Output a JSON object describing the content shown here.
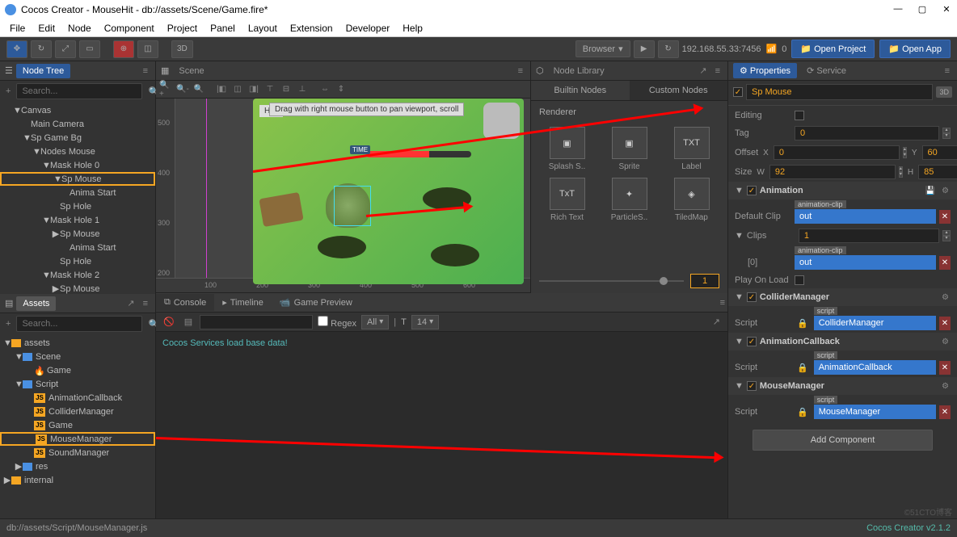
{
  "titlebar": {
    "title": "Cocos Creator - MouseHit - db://assets/Scene/Game.fire*"
  },
  "menubar": [
    "File",
    "Edit",
    "Node",
    "Component",
    "Project",
    "Panel",
    "Layout",
    "Extension",
    "Developer",
    "Help"
  ],
  "toolbar": {
    "mode_3d": "3D",
    "device": "Browser",
    "ip": "192.168.55.33:7456",
    "conn": "0",
    "open_project": "Open Project",
    "open_app": "Open App"
  },
  "node_tree": {
    "title": "Node Tree",
    "search_placeholder": "Search...",
    "items": [
      {
        "label": "Canvas",
        "indent": 1,
        "arrow": "▼"
      },
      {
        "label": "Main Camera",
        "indent": 2,
        "arrow": ""
      },
      {
        "label": "Sp Game Bg",
        "indent": 2,
        "arrow": "▼"
      },
      {
        "label": "Nodes Mouse",
        "indent": 3,
        "arrow": "▼"
      },
      {
        "label": "Mask Hole 0",
        "indent": 4,
        "arrow": "▼"
      },
      {
        "label": "Sp Mouse",
        "indent": 5,
        "arrow": "▼",
        "hl": true
      },
      {
        "label": "Anima Start",
        "indent": 6,
        "arrow": ""
      },
      {
        "label": "Sp Hole",
        "indent": 5,
        "arrow": ""
      },
      {
        "label": "Mask Hole 1",
        "indent": 4,
        "arrow": "▼"
      },
      {
        "label": "Sp Mouse",
        "indent": 5,
        "arrow": "▶"
      },
      {
        "label": "Anima Start",
        "indent": 6,
        "arrow": ""
      },
      {
        "label": "Sp Hole",
        "indent": 5,
        "arrow": ""
      },
      {
        "label": "Mask Hole 2",
        "indent": 4,
        "arrow": "▼"
      },
      {
        "label": "Sp Mouse",
        "indent": 5,
        "arrow": "▶"
      }
    ]
  },
  "assets": {
    "title": "Assets",
    "search_placeholder": "Search...",
    "items": [
      {
        "label": "assets",
        "indent": 0,
        "arrow": "▼",
        "icon": "folder-orange"
      },
      {
        "label": "Scene",
        "indent": 1,
        "arrow": "▼",
        "icon": "folder"
      },
      {
        "label": "Game",
        "indent": 2,
        "arrow": "",
        "icon": "fire"
      },
      {
        "label": "Script",
        "indent": 1,
        "arrow": "▼",
        "icon": "folder"
      },
      {
        "label": "AnimationCallback",
        "indent": 2,
        "arrow": "",
        "icon": "js"
      },
      {
        "label": "ColliderManager",
        "indent": 2,
        "arrow": "",
        "icon": "js"
      },
      {
        "label": "Game",
        "indent": 2,
        "arrow": "",
        "icon": "js"
      },
      {
        "label": "MouseManager",
        "indent": 2,
        "arrow": "",
        "icon": "js",
        "hl": true
      },
      {
        "label": "SoundManager",
        "indent": 2,
        "arrow": "",
        "icon": "js"
      },
      {
        "label": "res",
        "indent": 1,
        "arrow": "▶",
        "icon": "folder"
      },
      {
        "label": "internal",
        "indent": 0,
        "arrow": "▶",
        "icon": "folder-orange"
      }
    ]
  },
  "scene": {
    "title": "Scene",
    "hint": "Drag with right mouse button to pan viewport, scroll",
    "hall": "Hall",
    "ruler_v": [
      "500",
      "400",
      "300",
      "200"
    ],
    "ruler_h": [
      "100",
      "200",
      "300",
      "400",
      "500",
      "600"
    ]
  },
  "nodelib": {
    "title": "Node Library",
    "tabs": [
      "Builtin Nodes",
      "Custom Nodes"
    ],
    "section": "Renderer",
    "items": [
      {
        "label": "Splash S..",
        "glyph": "▣"
      },
      {
        "label": "Sprite",
        "glyph": "▣"
      },
      {
        "label": "Label",
        "glyph": "TXT"
      },
      {
        "label": "Rich Text",
        "glyph": "TxT"
      },
      {
        "label": "ParticleS..",
        "glyph": "✦"
      },
      {
        "label": "TiledMap",
        "glyph": "◈"
      }
    ],
    "slider": "1"
  },
  "console": {
    "tabs": [
      "Console",
      "Timeline",
      "Game Preview"
    ],
    "regex": "Regex",
    "filter": "All",
    "fontsize": "14",
    "log": "Cocos Services load base data!"
  },
  "properties": {
    "tab1": "Properties",
    "tab2": "Service",
    "node_name": "Sp Mouse",
    "badge_3d": "3D",
    "rows": {
      "editing": "Editing",
      "tag": "Tag",
      "tag_val": "0",
      "offset": "Offset",
      "offset_x": "0",
      "offset_y": "60",
      "size": "Size",
      "size_w": "92",
      "size_h": "85"
    },
    "animation": {
      "title": "Animation",
      "default_clip": "Default Clip",
      "default_clip_val": "out",
      "clip_tag": "animation-clip",
      "clips": "Clips",
      "clips_val": "1",
      "clips_idx": "[0]",
      "clips_item": "out",
      "play_on_load": "Play On Load"
    },
    "components": [
      {
        "title": "ColliderManager",
        "script": "Script",
        "script_val": "ColliderManager",
        "tag": "script"
      },
      {
        "title": "AnimationCallback",
        "script": "Script",
        "script_val": "AnimationCallback",
        "tag": "script"
      },
      {
        "title": "MouseManager",
        "script": "Script",
        "script_val": "MouseManager",
        "tag": "script"
      }
    ],
    "add_component": "Add Component"
  },
  "statusbar": {
    "path": "db://assets/Script/MouseManager.js",
    "version": "Cocos Creator v2.1.2"
  },
  "watermark": "©51CTO博客"
}
